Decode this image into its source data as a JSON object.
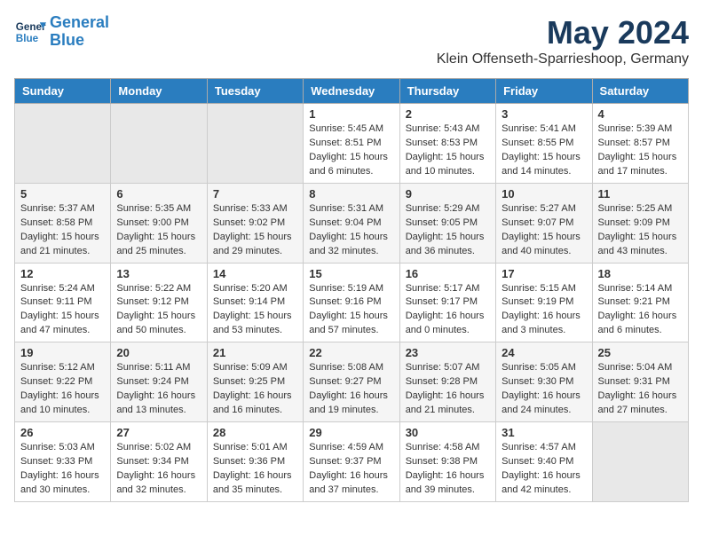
{
  "logo": {
    "line1": "General",
    "line2": "Blue"
  },
  "title": "May 2024",
  "subtitle": "Klein Offenseth-Sparrieshoop, Germany",
  "days_header": [
    "Sunday",
    "Monday",
    "Tuesday",
    "Wednesday",
    "Thursday",
    "Friday",
    "Saturday"
  ],
  "weeks": [
    [
      {
        "num": "",
        "info": "",
        "empty": true
      },
      {
        "num": "",
        "info": "",
        "empty": true
      },
      {
        "num": "",
        "info": "",
        "empty": true
      },
      {
        "num": "1",
        "info": "Sunrise: 5:45 AM\nSunset: 8:51 PM\nDaylight: 15 hours\nand 6 minutes."
      },
      {
        "num": "2",
        "info": "Sunrise: 5:43 AM\nSunset: 8:53 PM\nDaylight: 15 hours\nand 10 minutes."
      },
      {
        "num": "3",
        "info": "Sunrise: 5:41 AM\nSunset: 8:55 PM\nDaylight: 15 hours\nand 14 minutes."
      },
      {
        "num": "4",
        "info": "Sunrise: 5:39 AM\nSunset: 8:57 PM\nDaylight: 15 hours\nand 17 minutes."
      }
    ],
    [
      {
        "num": "5",
        "info": "Sunrise: 5:37 AM\nSunset: 8:58 PM\nDaylight: 15 hours\nand 21 minutes."
      },
      {
        "num": "6",
        "info": "Sunrise: 5:35 AM\nSunset: 9:00 PM\nDaylight: 15 hours\nand 25 minutes."
      },
      {
        "num": "7",
        "info": "Sunrise: 5:33 AM\nSunset: 9:02 PM\nDaylight: 15 hours\nand 29 minutes."
      },
      {
        "num": "8",
        "info": "Sunrise: 5:31 AM\nSunset: 9:04 PM\nDaylight: 15 hours\nand 32 minutes."
      },
      {
        "num": "9",
        "info": "Sunrise: 5:29 AM\nSunset: 9:05 PM\nDaylight: 15 hours\nand 36 minutes."
      },
      {
        "num": "10",
        "info": "Sunrise: 5:27 AM\nSunset: 9:07 PM\nDaylight: 15 hours\nand 40 minutes."
      },
      {
        "num": "11",
        "info": "Sunrise: 5:25 AM\nSunset: 9:09 PM\nDaylight: 15 hours\nand 43 minutes."
      }
    ],
    [
      {
        "num": "12",
        "info": "Sunrise: 5:24 AM\nSunset: 9:11 PM\nDaylight: 15 hours\nand 47 minutes."
      },
      {
        "num": "13",
        "info": "Sunrise: 5:22 AM\nSunset: 9:12 PM\nDaylight: 15 hours\nand 50 minutes."
      },
      {
        "num": "14",
        "info": "Sunrise: 5:20 AM\nSunset: 9:14 PM\nDaylight: 15 hours\nand 53 minutes."
      },
      {
        "num": "15",
        "info": "Sunrise: 5:19 AM\nSunset: 9:16 PM\nDaylight: 15 hours\nand 57 minutes."
      },
      {
        "num": "16",
        "info": "Sunrise: 5:17 AM\nSunset: 9:17 PM\nDaylight: 16 hours\nand 0 minutes."
      },
      {
        "num": "17",
        "info": "Sunrise: 5:15 AM\nSunset: 9:19 PM\nDaylight: 16 hours\nand 3 minutes."
      },
      {
        "num": "18",
        "info": "Sunrise: 5:14 AM\nSunset: 9:21 PM\nDaylight: 16 hours\nand 6 minutes."
      }
    ],
    [
      {
        "num": "19",
        "info": "Sunrise: 5:12 AM\nSunset: 9:22 PM\nDaylight: 16 hours\nand 10 minutes."
      },
      {
        "num": "20",
        "info": "Sunrise: 5:11 AM\nSunset: 9:24 PM\nDaylight: 16 hours\nand 13 minutes."
      },
      {
        "num": "21",
        "info": "Sunrise: 5:09 AM\nSunset: 9:25 PM\nDaylight: 16 hours\nand 16 minutes."
      },
      {
        "num": "22",
        "info": "Sunrise: 5:08 AM\nSunset: 9:27 PM\nDaylight: 16 hours\nand 19 minutes."
      },
      {
        "num": "23",
        "info": "Sunrise: 5:07 AM\nSunset: 9:28 PM\nDaylight: 16 hours\nand 21 minutes."
      },
      {
        "num": "24",
        "info": "Sunrise: 5:05 AM\nSunset: 9:30 PM\nDaylight: 16 hours\nand 24 minutes."
      },
      {
        "num": "25",
        "info": "Sunrise: 5:04 AM\nSunset: 9:31 PM\nDaylight: 16 hours\nand 27 minutes."
      }
    ],
    [
      {
        "num": "26",
        "info": "Sunrise: 5:03 AM\nSunset: 9:33 PM\nDaylight: 16 hours\nand 30 minutes."
      },
      {
        "num": "27",
        "info": "Sunrise: 5:02 AM\nSunset: 9:34 PM\nDaylight: 16 hours\nand 32 minutes."
      },
      {
        "num": "28",
        "info": "Sunrise: 5:01 AM\nSunset: 9:36 PM\nDaylight: 16 hours\nand 35 minutes."
      },
      {
        "num": "29",
        "info": "Sunrise: 4:59 AM\nSunset: 9:37 PM\nDaylight: 16 hours\nand 37 minutes."
      },
      {
        "num": "30",
        "info": "Sunrise: 4:58 AM\nSunset: 9:38 PM\nDaylight: 16 hours\nand 39 minutes."
      },
      {
        "num": "31",
        "info": "Sunrise: 4:57 AM\nSunset: 9:40 PM\nDaylight: 16 hours\nand 42 minutes."
      },
      {
        "num": "",
        "info": "",
        "empty": true
      }
    ]
  ]
}
